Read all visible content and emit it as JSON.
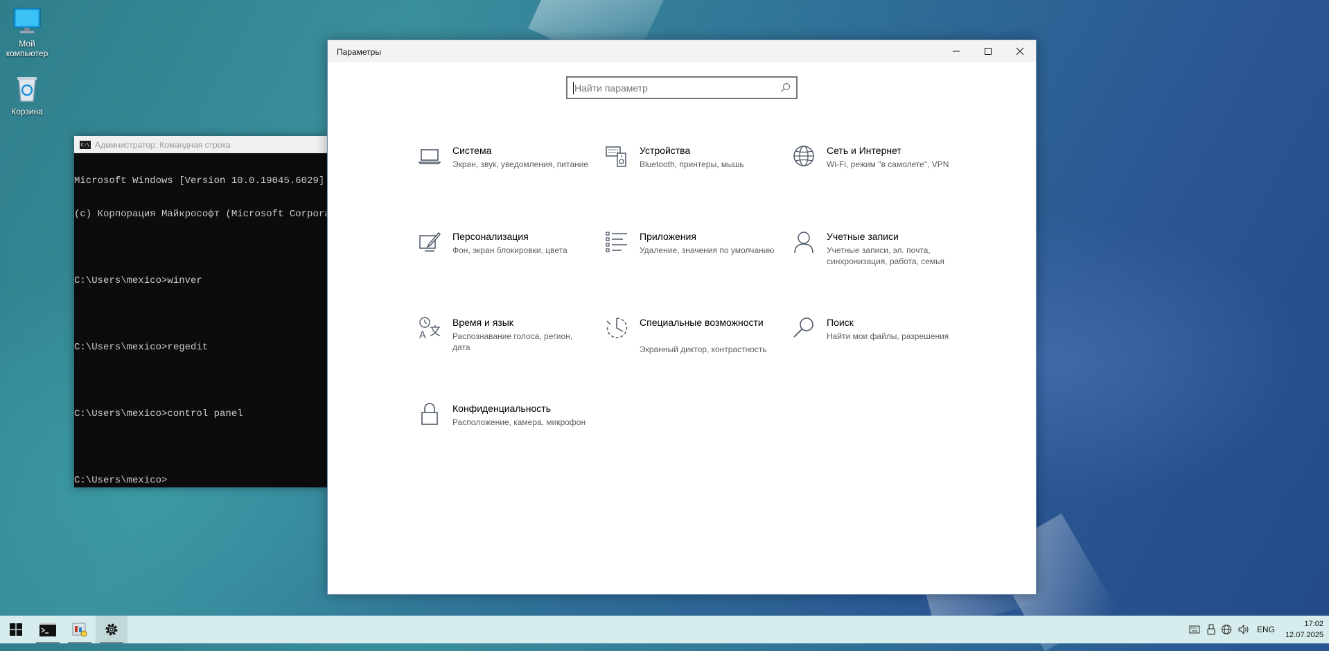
{
  "desktop": {
    "icons": [
      {
        "label": "Мой компьютер"
      },
      {
        "label": "Корзина"
      }
    ]
  },
  "cmd": {
    "title": "Администратор: Командная строка",
    "lines": [
      "Microsoft Windows [Version 10.0.19045.6029]",
      "(c) Корпорация Майкрософт (Microsoft Corporation). Все права защищены.",
      "",
      "C:\\Users\\mexico>winver",
      "",
      "C:\\Users\\mexico>regedit",
      "",
      "C:\\Users\\mexico>control panel",
      "",
      "C:\\Users\\mexico>"
    ]
  },
  "settings": {
    "title": "Параметры",
    "search_placeholder": "Найти параметр",
    "categories": [
      {
        "name": "Система",
        "desc": "Экран, звук, уведомления, питание",
        "icon": "laptop-icon"
      },
      {
        "name": "Устройства",
        "desc": "Bluetooth, принтеры, мышь",
        "icon": "devices-icon"
      },
      {
        "name": "Сеть и Интернет",
        "desc": "Wi-Fi, режим \"в самолете\", VPN",
        "icon": "globe-icon"
      },
      {
        "name": "Персонализация",
        "desc": "Фон, экран блокировки, цвета",
        "icon": "paint-icon"
      },
      {
        "name": "Приложения",
        "desc": "Удаление, значения по умолчанию",
        "icon": "apps-list-icon"
      },
      {
        "name": "Учетные записи",
        "desc": "Учетные записи, эл. почта, синхронизация, работа, семья",
        "icon": "person-icon"
      },
      {
        "name": "Время и язык",
        "desc": "Распознавание голоса, регион, дата",
        "icon": "time-language-icon"
      },
      {
        "name": "Специальные возможности",
        "desc": "Экранный диктор, контрастность",
        "icon": "accessibility-icon"
      },
      {
        "name": "Поиск",
        "desc": "Найти мои файлы, разрешения",
        "icon": "search-icon"
      },
      {
        "name": "Конфиденциальность",
        "desc": "Расположение, камера, микрофон",
        "icon": "lock-icon"
      }
    ]
  },
  "taskbar": {
    "language": "ENG",
    "time": "17:02",
    "date": "12.07.2025"
  },
  "colors": {
    "accent": "#0078d7",
    "icon_stroke": "#4d5866"
  }
}
